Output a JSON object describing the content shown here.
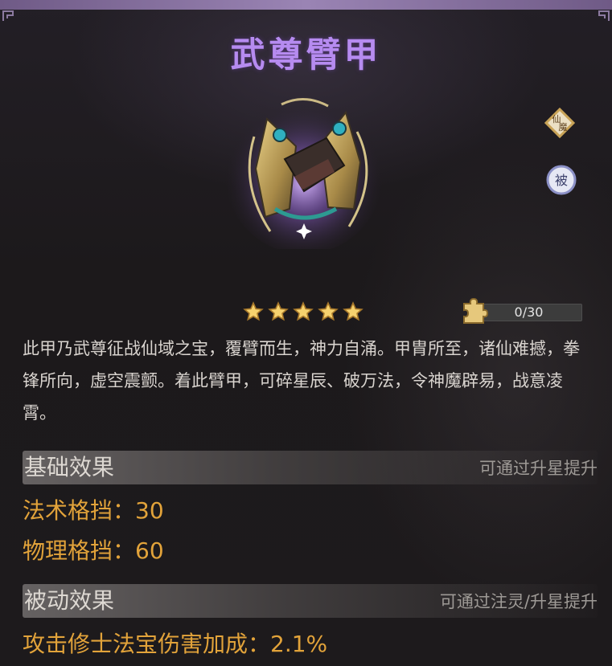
{
  "item": {
    "name": "武尊臂甲",
    "icon": "arm-guard-armor-icon",
    "stars": 5,
    "badges": [
      {
        "text": "仙魔",
        "icon": "xianmo-badge-icon"
      },
      {
        "text": "被",
        "icon": "passive-badge-icon"
      }
    ],
    "fragments": {
      "text": "0/30",
      "current": 0,
      "max": 30,
      "icon": "puzzle-piece-icon"
    },
    "description": "此甲乃武尊征战仙域之宝，覆臂而生，神力自涌。甲胄所至，诸仙难撼，拳锋所向，虚空震颤。着此臂甲，可碎星辰、破万法，令神魔辟易，战意凌霄。"
  },
  "sections": {
    "base": {
      "title": "基础效果",
      "hint": "可通过升星提升",
      "stats": [
        {
          "label": "法术格挡：30"
        },
        {
          "label": "物理格挡：60"
        }
      ]
    },
    "passive": {
      "title": "被动效果",
      "hint": "可通过注灵/升星提升",
      "stats": [
        {
          "label": "攻击修士法宝伤害加成：2.1%"
        }
      ]
    }
  },
  "colors": {
    "title": "#b68bf0",
    "stat": "#e2a33a",
    "description": "#d9d4cf",
    "hint": "#9e9a96",
    "star": "#f6d26e",
    "top_band": "#9a84b4"
  }
}
